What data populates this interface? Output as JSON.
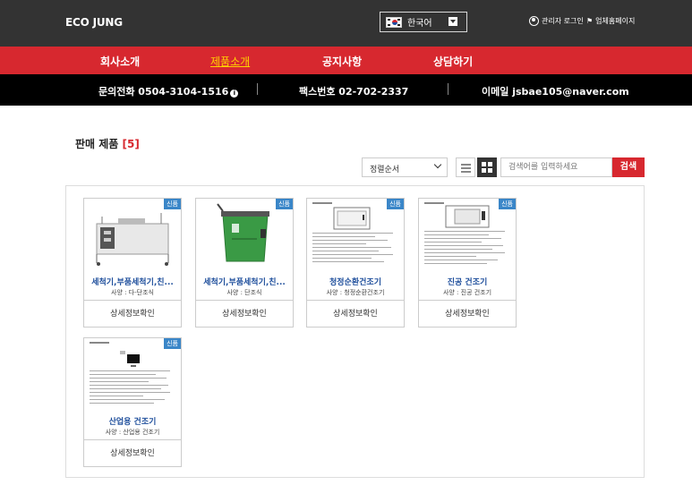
{
  "header": {
    "brand": "ECO JUNG",
    "language": "한국어",
    "login_label": "관리자 로그인",
    "company_label": "업체홈페이지"
  },
  "nav": {
    "items": [
      "회사소개",
      "제품소개",
      "공지사항",
      "상담하기"
    ],
    "active_index": 1
  },
  "contact": {
    "phone": "문의전화 0504-3104-1516",
    "fax": "팩스번호 02-702-2337",
    "email_label": "이메일",
    "email": "jsbae105@naver.com"
  },
  "section": {
    "title": "판매 제품",
    "count": "[5]"
  },
  "controls": {
    "sort_label": "정렬순서",
    "search_placeholder": "검색어를 입력하세요",
    "search_button": "검색"
  },
  "products": [
    {
      "name": "세척기,부품세척기,친...",
      "spec": "사양 : 다-단조식",
      "detail": "상세정보확인",
      "badge": "신품",
      "thumb": "machine-rack"
    },
    {
      "name": "세척기,부품세척기,친...",
      "spec": "사양 : 단조식",
      "detail": "상세정보확인",
      "badge": "신품",
      "thumb": "machine-green"
    },
    {
      "name": "청정순환건조기",
      "spec": "사양 : 청정순환건조기",
      "detail": "상세정보확인",
      "badge": "신품",
      "thumb": "document"
    },
    {
      "name": "진공 건조기",
      "spec": "사양 : 진공 건조기",
      "detail": "상세정보확인",
      "badge": "신품",
      "thumb": "document"
    },
    {
      "name": "산업용 건조기",
      "spec": "사양 : 산업용 건조기",
      "detail": "상세정보확인",
      "badge": "신품",
      "thumb": "document"
    }
  ],
  "colors": {
    "topbar": "#333333",
    "nav_red": "#d7282f",
    "nav_active": "#ffd200",
    "contact_bar": "#000000",
    "link_blue": "#1f4f9c",
    "badge_blue": "#3a86c8"
  }
}
